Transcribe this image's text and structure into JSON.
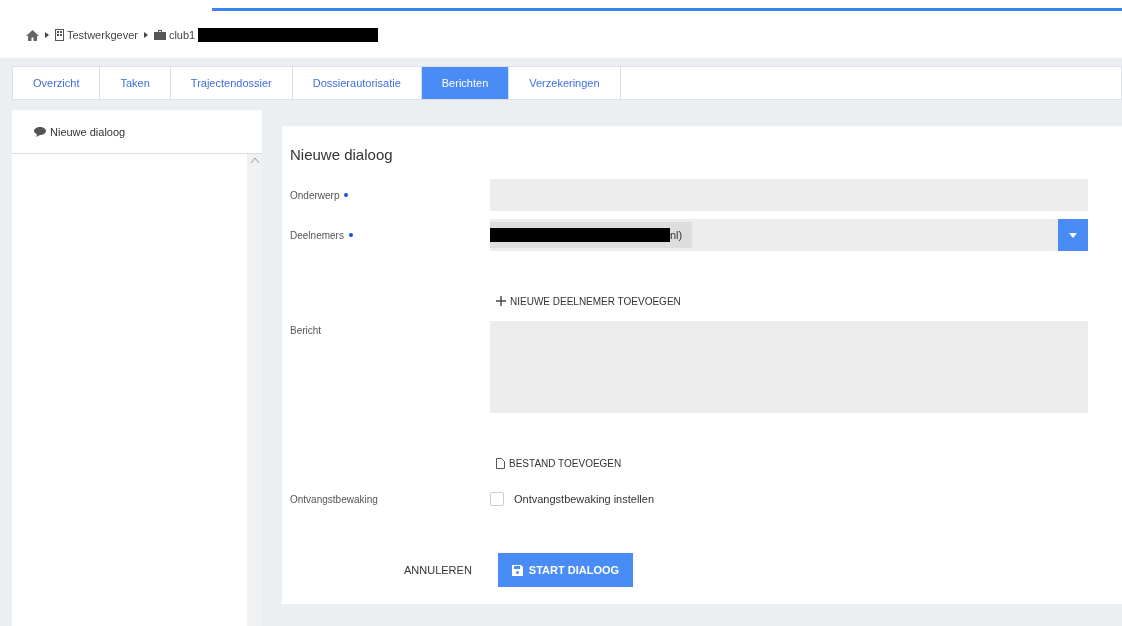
{
  "breadcrumb": [
    {
      "kind": "home"
    },
    {
      "kind": "building",
      "label": "Testwerkgever"
    },
    {
      "kind": "briefcase",
      "label": "club1",
      "redacted": true
    }
  ],
  "tabs": [
    {
      "label": "Overzicht",
      "selected": false
    },
    {
      "label": "Taken",
      "selected": false
    },
    {
      "label": "Trajectendossier",
      "selected": false
    },
    {
      "label": "Dossierautorisatie",
      "selected": false
    },
    {
      "label": "Berichten",
      "selected": true
    },
    {
      "label": "Verzekeringen",
      "selected": false
    }
  ],
  "sidebar": {
    "items": [
      {
        "label": "Nieuwe dialoog"
      }
    ]
  },
  "form": {
    "title": "Nieuwe dialoog",
    "subject": {
      "label": "Onderwerp",
      "required": true
    },
    "participants": {
      "label": "Deelnemers",
      "required": true,
      "chip": "nl)",
      "chip_redacted": true
    },
    "add_participant": "NIEUWE DEELNEMER TOEVOEGEN",
    "message": {
      "label": "Bericht"
    },
    "add_file": "BESTAND TOEVOEGEN",
    "receipt": {
      "label": "Ontvangstbewaking",
      "option": "Ontvangstbewaking instellen",
      "checked": false
    },
    "cancel": "ANNULEREN",
    "submit": "START DIALOOG"
  }
}
